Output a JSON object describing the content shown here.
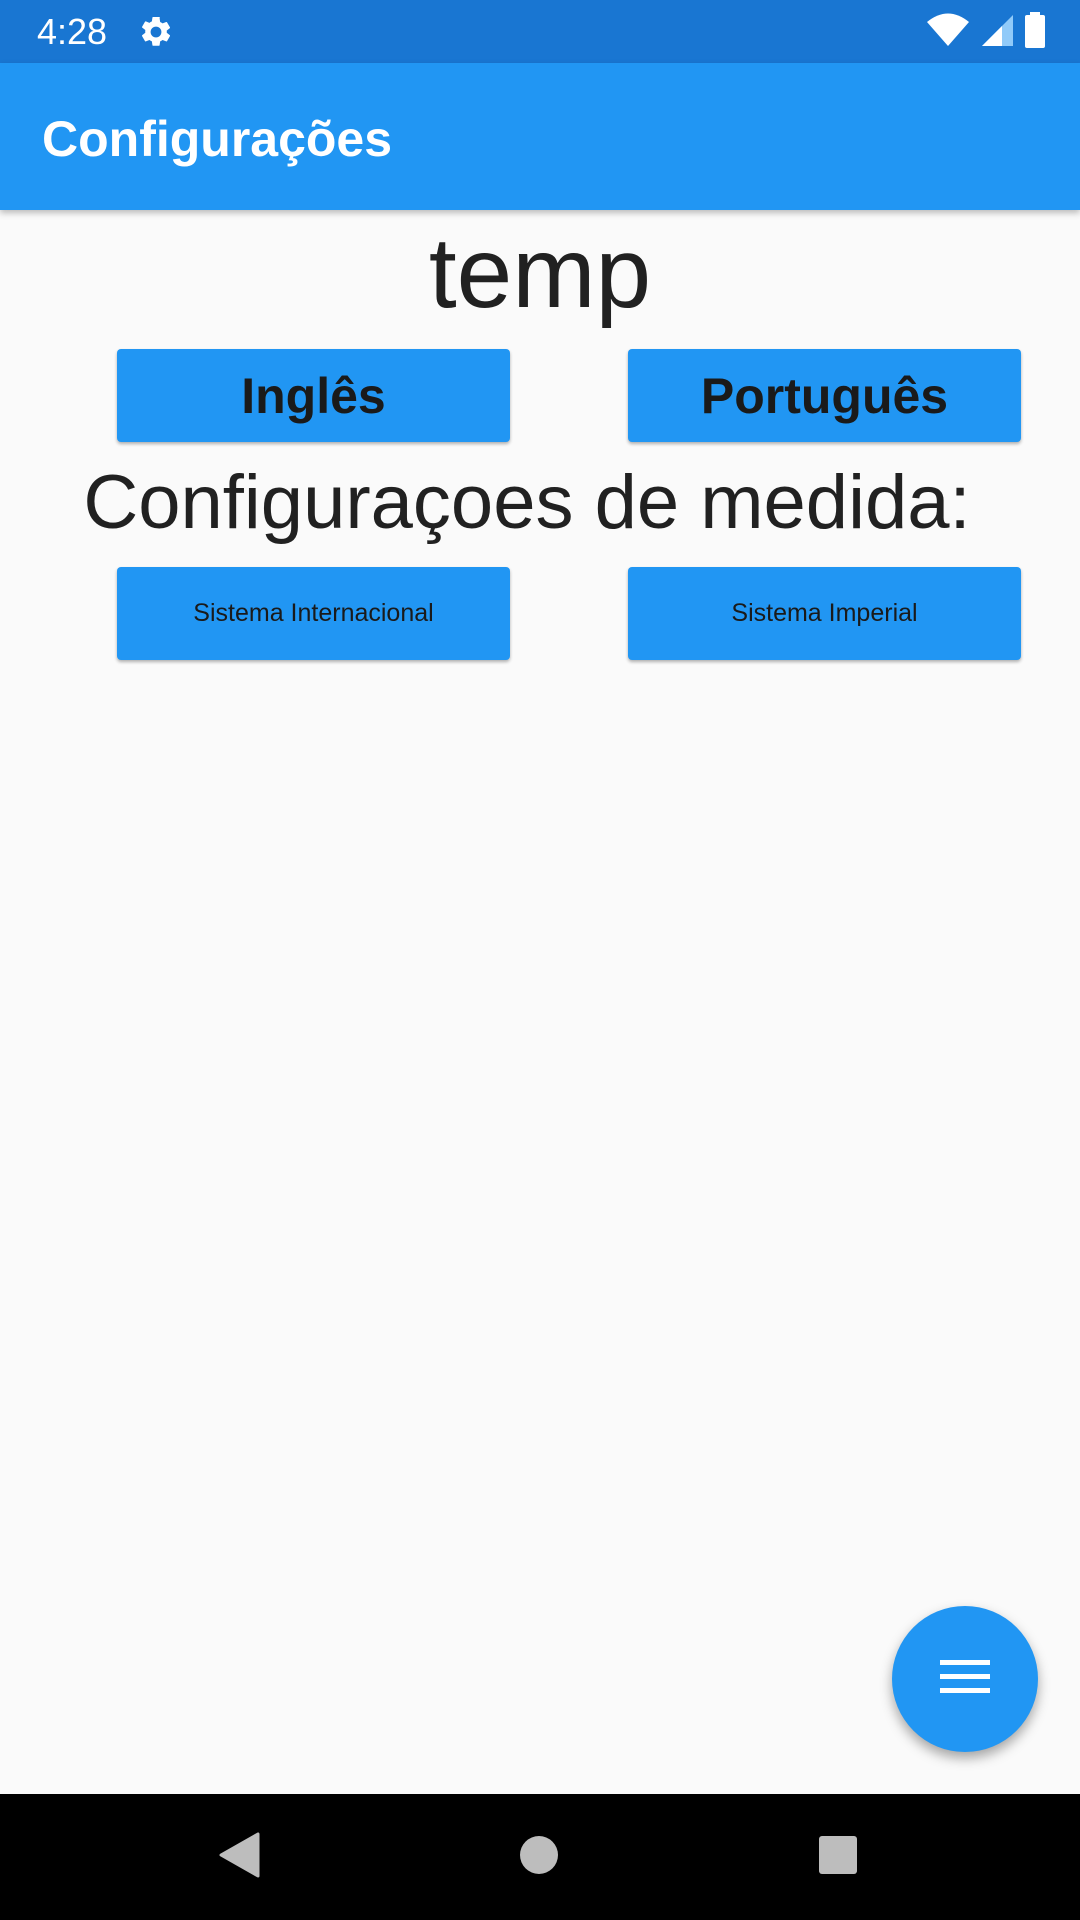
{
  "status_bar": {
    "time": "4:28",
    "icons": [
      "gear-icon",
      "wifi-icon",
      "signal-icon",
      "battery-icon"
    ],
    "background": "#1976d2"
  },
  "app_bar": {
    "title": "Configurações",
    "background": "#2196f3"
  },
  "main": {
    "temp_label": "temp",
    "language_buttons": {
      "english_label": "Inglês",
      "portuguese_label": "Português"
    },
    "measure_title": "Configuraçoes de medida:",
    "unit_buttons": {
      "international_label": "Sistema Internacional",
      "imperial_label": "Sistema Imperial"
    }
  },
  "fab": {
    "icon": "menu-icon",
    "color": "#2196f3"
  },
  "nav_bar": {
    "icons": [
      "back-icon",
      "home-icon",
      "recents-icon"
    ]
  }
}
